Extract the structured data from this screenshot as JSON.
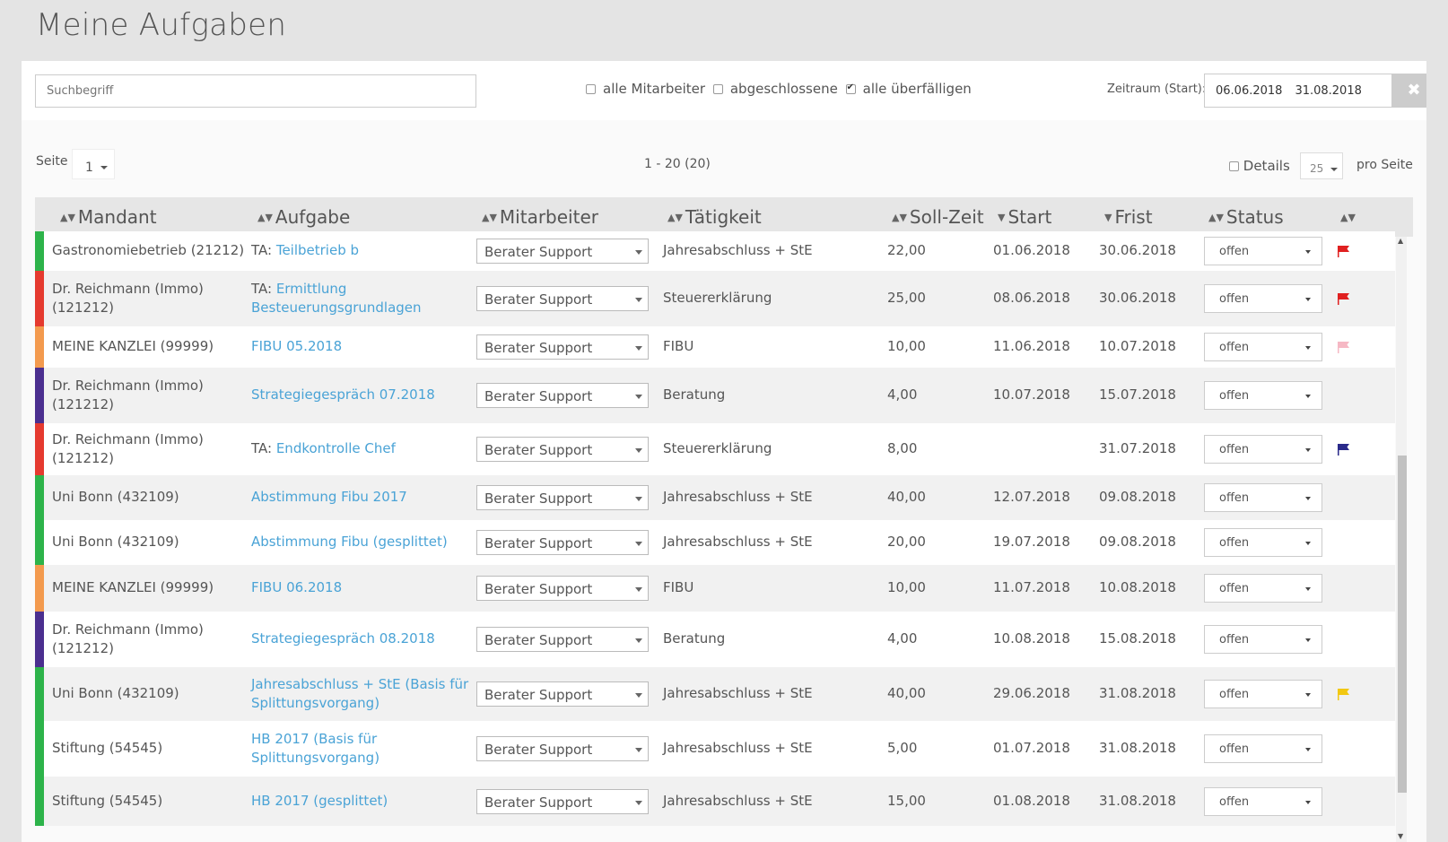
{
  "page": {
    "title": "Meine Aufgaben"
  },
  "filters": {
    "search_placeholder": "Suchbegriff",
    "options": [
      {
        "label": "alle Mitarbeiter",
        "checked": false
      },
      {
        "label": "abgeschlossene",
        "checked": false
      },
      {
        "label": "alle überfälligen",
        "checked": true
      }
    ],
    "zeitraum_label": "Zeitraum (Start):",
    "date_from": "06.06.2018",
    "date_to": "31.08.2018",
    "clear_icon": "close-icon"
  },
  "pagination": {
    "seite_label": "Seite",
    "page": "1",
    "range_text": "1 - 20 (20)",
    "details_label": "Details",
    "per_page": "25",
    "per_page_label": "pro Seite"
  },
  "columns": [
    "Mandant",
    "Aufgabe",
    "Mitarbeiter",
    "Tätigkeit",
    "Soll-Zeit",
    "Start",
    "Frist",
    "Status"
  ],
  "rows": [
    {
      "color": "#2db34a",
      "mandant": [
        "Gastronomiebetrieb (21212)"
      ],
      "prefix": "TA: ",
      "aufgabe": [
        "Teilbetrieb b"
      ],
      "mitarbeiter": "Berater Support",
      "taetigkeit": "Jahresabschluss + StE",
      "soll": "22,00",
      "start": "01.06.2018",
      "frist": "30.06.2018",
      "status": "offen",
      "flag": "#e02020"
    },
    {
      "color": "#e53a2f",
      "mandant": [
        "Dr. Reichmann (Immo)",
        "(121212)"
      ],
      "prefix": "TA: ",
      "aufgabe": [
        "Ermittlung",
        "Besteuerungsgrundlagen"
      ],
      "mitarbeiter": "Berater Support",
      "taetigkeit": "Steuererklärung",
      "soll": "25,00",
      "start": "08.06.2018",
      "frist": "30.06.2018",
      "status": "offen",
      "flag": "#e02020"
    },
    {
      "color": "#f39a4e",
      "mandant": [
        "MEINE KANZLEI (99999)"
      ],
      "prefix": "",
      "aufgabe": [
        "FIBU 05.2018"
      ],
      "mitarbeiter": "Berater Support",
      "taetigkeit": "FIBU",
      "soll": "10,00",
      "start": "11.06.2018",
      "frist": "10.07.2018",
      "status": "offen",
      "flag": "#f6b8c4"
    },
    {
      "color": "#4b2f8f",
      "mandant": [
        "Dr. Reichmann (Immo)",
        "(121212)"
      ],
      "prefix": "",
      "aufgabe": [
        "Strategiegespräch 07.2018"
      ],
      "mitarbeiter": "Berater Support",
      "taetigkeit": "Beratung",
      "soll": "4,00",
      "start": "10.07.2018",
      "frist": "15.07.2018",
      "status": "offen",
      "flag": ""
    },
    {
      "color": "#e53a2f",
      "mandant": [
        "Dr. Reichmann (Immo)",
        "(121212)"
      ],
      "prefix": "TA: ",
      "aufgabe": [
        "Endkontrolle Chef"
      ],
      "mitarbeiter": "Berater Support",
      "taetigkeit": "Steuererklärung",
      "soll": "8,00",
      "start": "",
      "frist": "31.07.2018",
      "status": "offen",
      "flag": "#2a2a8a"
    },
    {
      "color": "#2db34a",
      "mandant": [
        "Uni Bonn (432109)"
      ],
      "prefix": "",
      "aufgabe": [
        "Abstimmung Fibu 2017"
      ],
      "mitarbeiter": "Berater Support",
      "taetigkeit": "Jahresabschluss + StE",
      "soll": "40,00",
      "start": "12.07.2018",
      "frist": "09.08.2018",
      "status": "offen",
      "flag": ""
    },
    {
      "color": "#2db34a",
      "mandant": [
        "Uni Bonn (432109)"
      ],
      "prefix": "",
      "aufgabe": [
        "Abstimmung Fibu (gesplittet)"
      ],
      "mitarbeiter": "Berater Support",
      "taetigkeit": "Jahresabschluss + StE",
      "soll": "20,00",
      "start": "19.07.2018",
      "frist": "09.08.2018",
      "status": "offen",
      "flag": ""
    },
    {
      "color": "#f39a4e",
      "mandant": [
        "MEINE KANZLEI (99999)"
      ],
      "prefix": "",
      "aufgabe": [
        "FIBU 06.2018"
      ],
      "mitarbeiter": "Berater Support",
      "taetigkeit": "FIBU",
      "soll": "10,00",
      "start": "11.07.2018",
      "frist": "10.08.2018",
      "status": "offen",
      "flag": ""
    },
    {
      "color": "#4b2f8f",
      "mandant": [
        "Dr. Reichmann (Immo)",
        "(121212)"
      ],
      "prefix": "",
      "aufgabe": [
        "Strategiegespräch 08.2018"
      ],
      "mitarbeiter": "Berater Support",
      "taetigkeit": "Beratung",
      "soll": "4,00",
      "start": "10.08.2018",
      "frist": "15.08.2018",
      "status": "offen",
      "flag": ""
    },
    {
      "color": "#2db34a",
      "mandant": [
        "Uni Bonn (432109)"
      ],
      "prefix": "",
      "aufgabe": [
        "Jahresabschluss + StE (Basis für",
        "Splittungsvorgang)"
      ],
      "mitarbeiter": "Berater Support",
      "taetigkeit": "Jahresabschluss + StE",
      "soll": "40,00",
      "start": "29.06.2018",
      "frist": "31.08.2018",
      "status": "offen",
      "flag": "#f2c811"
    },
    {
      "color": "#2db34a",
      "mandant": [
        "Stiftung (54545)"
      ],
      "prefix": "",
      "aufgabe": [
        "HB 2017 (Basis für",
        "Splittungsvorgang)"
      ],
      "mitarbeiter": "Berater Support",
      "taetigkeit": "Jahresabschluss + StE",
      "soll": "5,00",
      "start": "01.07.2018",
      "frist": "31.08.2018",
      "status": "offen",
      "flag": ""
    },
    {
      "color": "#2db34a",
      "mandant": [
        "Stiftung (54545)"
      ],
      "prefix": "",
      "aufgabe": [
        "HB 2017 (gesplittet)"
      ],
      "mitarbeiter": "Berater Support",
      "taetigkeit": "Jahresabschluss + StE",
      "soll": "15,00",
      "start": "01.08.2018",
      "frist": "31.08.2018",
      "status": "offen",
      "flag": ""
    }
  ]
}
